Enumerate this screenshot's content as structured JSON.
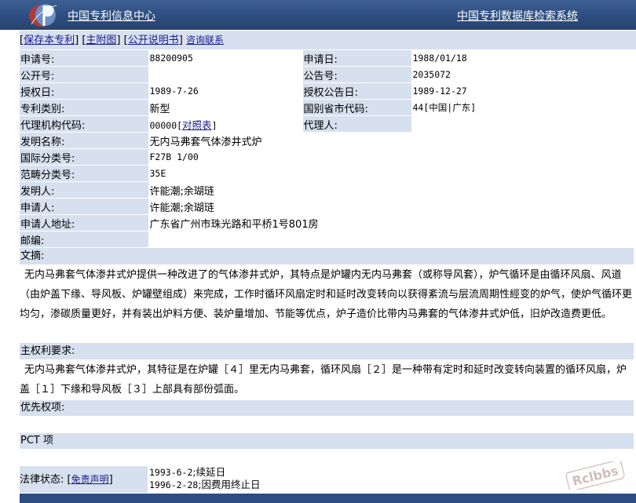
{
  "header": {
    "org_name": "中国专利信息中心",
    "system_name": "中国专利数据库检索系统"
  },
  "toolbar": {
    "save": "保存本专利",
    "main_figure": "主附图",
    "spec": "公开说明书",
    "consult": "咨询联系"
  },
  "fields": {
    "app_no_label": "申请号:",
    "app_no": "88200905",
    "app_date_label": "申请日:",
    "app_date": "1988/01/18",
    "pub_no_label": "公开号:",
    "pub_no": "",
    "announce_no_label": "公告号:",
    "announce_no": "2035072",
    "grant_date_label": "授权日:",
    "grant_date": "1989-7-26",
    "grant_pub_date_label": "授权公告日:",
    "grant_pub_date": "1989-12-27",
    "category_label": "专利类别:",
    "category": "新型",
    "country_code_label": "国别省市代码:",
    "country_code": "44[中国|广东]",
    "agency_code_label": "代理机构代码:",
    "agency_code": "00000[",
    "agency_link": "对照表",
    "agency_code_end": "]",
    "agent_label": "代理人:",
    "agent": "",
    "title_label": "发明名称:",
    "title": "无内马弗套气体渗井式炉",
    "ipc_label": "国际分类号:",
    "ipc": "F27B 1/00",
    "scope_label": "范畴分类号:",
    "scope": "35E",
    "inventor_label": "发明人:",
    "inventor": "许能潮;余瑚琏",
    "applicant_label": "申请人:",
    "applicant": "许能潮;余瑚琏",
    "address_label": "申请人地址:",
    "address": "广东省广州市珠光路和平桥1号801房",
    "postcode_label": "邮编:",
    "postcode": ""
  },
  "abstract": {
    "label": "文摘:",
    "text": "无内马弗套气体渗井式炉提供一种改进了的气体渗井式炉，其特点是炉罐内无内马弗套（或称导风套），炉气循环是由循环风扇、风道（由炉盖下缘、导风板、炉罐壁组成）来完成，工作时循环风扇定时和延时改变转向以获得紊流与层流周期性經变的炉气，使炉气循环更均匀，渗碳质量更好，并有装出炉料方便、装炉量增加、节能等优点，炉子造价比带内马弗套的气体渗井式炉低，旧炉改造费更低。"
  },
  "claims": {
    "label": "主权利要求:",
    "text": "无内马弗套气体渗井式炉，其特征是在炉罐［４］里无内马弗套，循环风扇［２］是一种带有定时和延时改变转向装置的循环风扇，炉盖［１］下缘和导风板［３］上部具有部份弧面。"
  },
  "priority": {
    "label": "优先权项:"
  },
  "pct": {
    "label": "PCT 项"
  },
  "legal": {
    "label": "法律状态:",
    "disclaimer": "免责声明",
    "line1_date": "1993-6-2",
    "line1_text": ";续延日",
    "line2_date": "1996-2-28",
    "line2_text": ";因费用终止日"
  },
  "watermark": {
    "text": "Rclbbs"
  },
  "colors": {
    "header": "#2e4d80",
    "label_bg": "#d6e0ee",
    "link": "#1a1a8f"
  }
}
